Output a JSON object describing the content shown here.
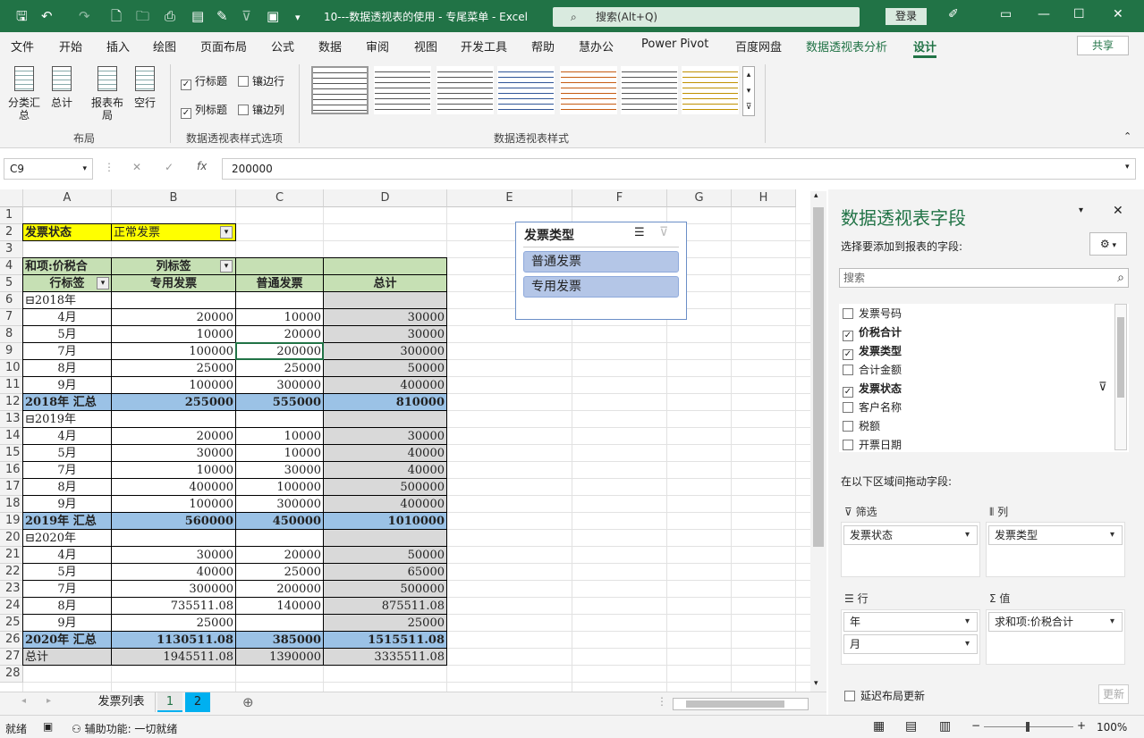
{
  "window": {
    "title": "10---数据透视表的使用 - 专尾菜单 - Excel",
    "search": "搜索(Alt+Q)",
    "login": "登录"
  },
  "tabs": [
    "文件",
    "开始",
    "插入",
    "绘图",
    "页面布局",
    "公式",
    "数据",
    "审阅",
    "视图",
    "开发工具",
    "帮助",
    "慧办公",
    "Power Pivot",
    "百度网盘",
    "数据透视表分析",
    "设计"
  ],
  "share": "共享",
  "ribbon": {
    "layout_buttons": [
      "分类汇总",
      "总计",
      "报表布局",
      "空行"
    ],
    "layout_group": "布局",
    "options": {
      "row_headers": "行标题",
      "banded_rows": "镶边行",
      "col_headers": "列标题",
      "banded_cols": "镶边列"
    },
    "options_group": "数据透视表样式选项",
    "styles_group": "数据透视表样式"
  },
  "formula": {
    "namebox": "C9",
    "value": "200000"
  },
  "columns": [
    "A",
    "B",
    "C",
    "D",
    "E",
    "F",
    "G",
    "H"
  ],
  "filter": {
    "label": "发票状态",
    "value": "正常发票"
  },
  "pivot": {
    "value_label": "和项:价税合",
    "col_label": "列标签",
    "row_label": "行标签",
    "col_heads": [
      "专用发票",
      "普通发票",
      "总计"
    ],
    "rows": [
      {
        "r": 6,
        "label": "⊟2018年",
        "kind": "year",
        "v": [
          "",
          "",
          ""
        ]
      },
      {
        "r": 7,
        "label": "4月",
        "kind": "m",
        "v": [
          "20000",
          "10000",
          "30000"
        ]
      },
      {
        "r": 8,
        "label": "5月",
        "kind": "m",
        "v": [
          "10000",
          "20000",
          "30000"
        ]
      },
      {
        "r": 9,
        "label": "7月",
        "kind": "m",
        "v": [
          "100000",
          "200000",
          "300000"
        ]
      },
      {
        "r": 10,
        "label": "8月",
        "kind": "m",
        "v": [
          "25000",
          "25000",
          "50000"
        ]
      },
      {
        "r": 11,
        "label": "9月",
        "kind": "m",
        "v": [
          "100000",
          "300000",
          "400000"
        ]
      },
      {
        "r": 12,
        "label": "2018年 汇总",
        "kind": "sub",
        "v": [
          "255000",
          "555000",
          "810000"
        ]
      },
      {
        "r": 13,
        "label": "⊟2019年",
        "kind": "year",
        "v": [
          "",
          "",
          ""
        ]
      },
      {
        "r": 14,
        "label": "4月",
        "kind": "m",
        "v": [
          "20000",
          "10000",
          "30000"
        ]
      },
      {
        "r": 15,
        "label": "5月",
        "kind": "m",
        "v": [
          "30000",
          "10000",
          "40000"
        ]
      },
      {
        "r": 16,
        "label": "7月",
        "kind": "m",
        "v": [
          "10000",
          "30000",
          "40000"
        ]
      },
      {
        "r": 17,
        "label": "8月",
        "kind": "m",
        "v": [
          "400000",
          "100000",
          "500000"
        ]
      },
      {
        "r": 18,
        "label": "9月",
        "kind": "m",
        "v": [
          "100000",
          "300000",
          "400000"
        ]
      },
      {
        "r": 19,
        "label": "2019年 汇总",
        "kind": "sub",
        "v": [
          "560000",
          "450000",
          "1010000"
        ]
      },
      {
        "r": 20,
        "label": "⊟2020年",
        "kind": "year",
        "v": [
          "",
          "",
          ""
        ]
      },
      {
        "r": 21,
        "label": "4月",
        "kind": "m",
        "v": [
          "30000",
          "20000",
          "50000"
        ]
      },
      {
        "r": 22,
        "label": "5月",
        "kind": "m",
        "v": [
          "40000",
          "25000",
          "65000"
        ]
      },
      {
        "r": 23,
        "label": "7月",
        "kind": "m",
        "v": [
          "300000",
          "200000",
          "500000"
        ]
      },
      {
        "r": 24,
        "label": "8月",
        "kind": "m",
        "v": [
          "735511.08",
          "140000",
          "875511.08"
        ]
      },
      {
        "r": 25,
        "label": "9月",
        "kind": "m",
        "v": [
          "25000",
          "",
          "25000"
        ]
      },
      {
        "r": 26,
        "label": "2020年 汇总",
        "kind": "sub",
        "v": [
          "1130511.08",
          "385000",
          "1515511.08"
        ]
      },
      {
        "r": 27,
        "label": "总计",
        "kind": "grand",
        "v": [
          "1945511.08",
          "1390000",
          "3335511.08"
        ]
      }
    ]
  },
  "slicer": {
    "title": "发票类型",
    "items": [
      "普通发票",
      "专用发票"
    ]
  },
  "sheets": [
    "发票列表",
    "1",
    "2"
  ],
  "status": {
    "ready": "就绪",
    "accessibility": "辅助功能: 一切就绪",
    "zoom": "100%"
  },
  "pane": {
    "title": "数据透视表字段",
    "subtitle": "选择要添加到报表的字段:",
    "search": "搜索",
    "fields": [
      {
        "name": "发票号码",
        "checked": false
      },
      {
        "name": "价税合计",
        "checked": true
      },
      {
        "name": "发票类型",
        "checked": true
      },
      {
        "name": "合计金额",
        "checked": false
      },
      {
        "name": "发票状态",
        "checked": true
      },
      {
        "name": "客户名称",
        "checked": false
      },
      {
        "name": "税额",
        "checked": false
      },
      {
        "name": "开票日期",
        "checked": false
      }
    ],
    "drag_hint": "在以下区域间拖动字段:",
    "areas": {
      "filter": "筛选",
      "columns": "列",
      "rows": "行",
      "values": "值"
    },
    "filter_items": [
      "发票状态"
    ],
    "column_items": [
      "发票类型"
    ],
    "row_items": [
      "年",
      "月"
    ],
    "value_items": [
      "求和项:价税合计"
    ],
    "defer": "延迟布局更新",
    "update": "更新"
  },
  "colors": {
    "accent": "#217346",
    "filter_yellow": "#ffff00",
    "header_green": "#c6e0b4",
    "subtotal_blue": "#9bc2e6",
    "total_gray": "#d9d9d9"
  }
}
